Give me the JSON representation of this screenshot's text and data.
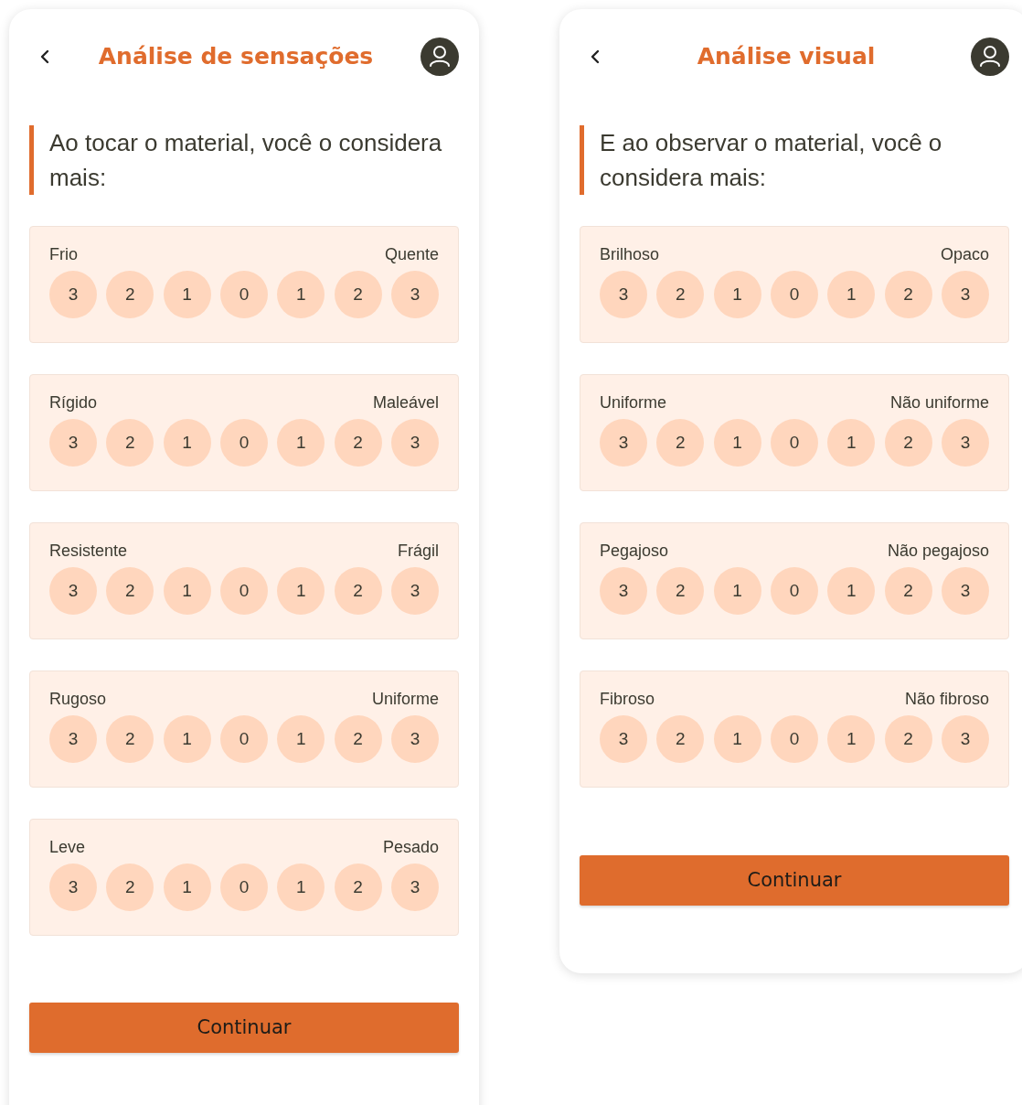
{
  "screens": [
    {
      "title": "Análise de sensações",
      "question": "Ao tocar o material, você o considera mais:",
      "scales": [
        {
          "left": "Frio",
          "right": "Quente",
          "points": [
            "3",
            "2",
            "1",
            "0",
            "1",
            "2",
            "3"
          ]
        },
        {
          "left": "Rígido",
          "right": "Maleável",
          "points": [
            "3",
            "2",
            "1",
            "0",
            "1",
            "2",
            "3"
          ]
        },
        {
          "left": "Resistente",
          "right": "Frágil",
          "points": [
            "3",
            "2",
            "1",
            "0",
            "1",
            "2",
            "3"
          ]
        },
        {
          "left": "Rugoso",
          "right": "Uniforme",
          "points": [
            "3",
            "2",
            "1",
            "0",
            "1",
            "2",
            "3"
          ]
        },
        {
          "left": "Leve",
          "right": "Pesado",
          "points": [
            "3",
            "2",
            "1",
            "0",
            "1",
            "2",
            "3"
          ]
        }
      ],
      "button": "Continuar"
    },
    {
      "title": "Análise visual",
      "question": "E ao observar o material, você o considera mais:",
      "scales": [
        {
          "left": "Brilhoso",
          "right": "Opaco",
          "points": [
            "3",
            "2",
            "1",
            "0",
            "1",
            "2",
            "3"
          ]
        },
        {
          "left": "Uniforme",
          "right": "Não uniforme",
          "points": [
            "3",
            "2",
            "1",
            "0",
            "1",
            "2",
            "3"
          ]
        },
        {
          "left": "Pegajoso",
          "right": "Não pegajoso",
          "points": [
            "3",
            "2",
            "1",
            "0",
            "1",
            "2",
            "3"
          ]
        },
        {
          "left": "Fibroso",
          "right": "Não fibroso",
          "points": [
            "3",
            "2",
            "1",
            "0",
            "1",
            "2",
            "3"
          ]
        }
      ],
      "button": "Continuar"
    }
  ]
}
